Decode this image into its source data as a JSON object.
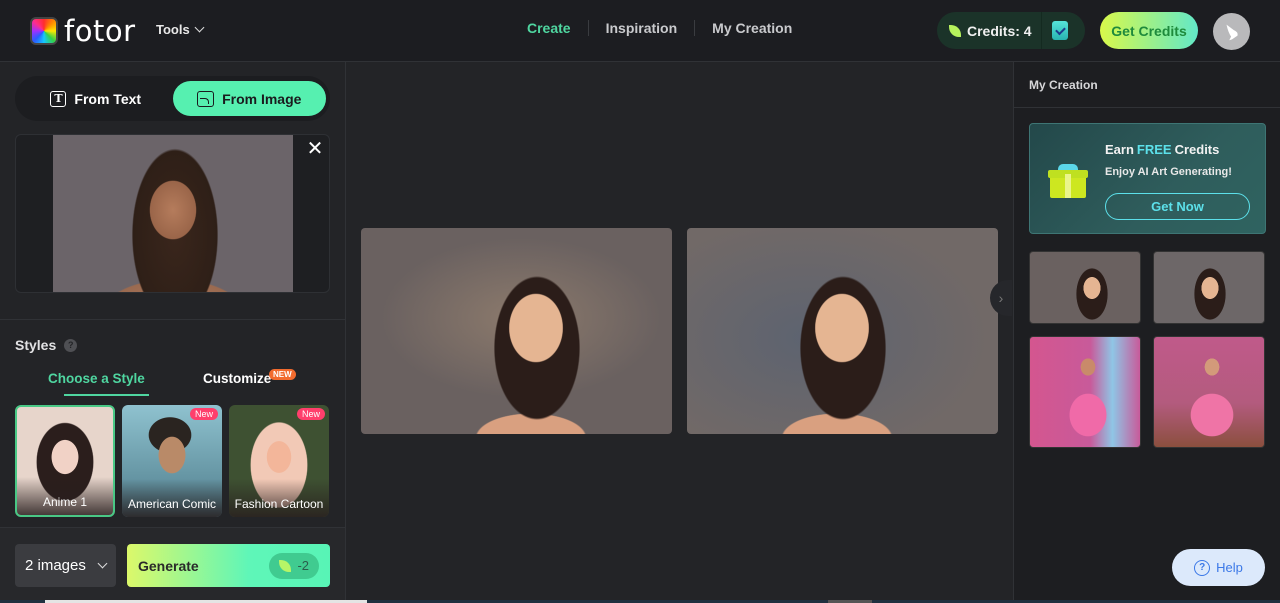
{
  "header": {
    "logo_text": "fotor",
    "tools_label": "Tools",
    "nav": [
      {
        "label": "Create",
        "active": true
      },
      {
        "label": "Inspiration",
        "active": false
      },
      {
        "label": "My Creation",
        "active": false
      }
    ],
    "credits_label": "Credits: 4",
    "get_credits_label": "Get Credits",
    "avatar_icon": "bird-icon"
  },
  "left_panel": {
    "mode_tabs": [
      {
        "label": "From Text",
        "icon": "text-icon",
        "active": false
      },
      {
        "label": "From Image",
        "icon": "image-icon",
        "active": true
      }
    ],
    "upload": {
      "has_image": true,
      "close_icon": "close-icon"
    },
    "styles": {
      "title": "Styles",
      "help_icon": "question-icon",
      "tabs": [
        {
          "label": "Choose a Style",
          "active": true
        },
        {
          "label": "Customize",
          "badge": "NEW",
          "active": false
        }
      ],
      "cards": [
        {
          "label": "Anime 1",
          "selected": true,
          "badge": ""
        },
        {
          "label": "American Comic",
          "selected": false,
          "badge": "New"
        },
        {
          "label": "Fashion Cartoon",
          "selected": false,
          "badge": "New"
        }
      ]
    },
    "image_count": "2 images",
    "generate_label": "Generate",
    "generate_cost": "-2"
  },
  "center": {
    "results": [
      {
        "name": "result-image-1"
      },
      {
        "name": "result-image-2"
      }
    ],
    "next_icon": "chevron-right-icon"
  },
  "right_panel": {
    "title": "My Creation",
    "promo": {
      "title_pre": "Earn",
      "title_free": "FREE",
      "title_post": "Credits",
      "subtitle": "Enjoy AI Art Generating!",
      "button": "Get Now"
    },
    "thumbnails": 4,
    "help_label": "Help"
  },
  "colors": {
    "accent": "#4fd6a0",
    "accent_button": "#56f0b0",
    "promo_cyan": "#5ce0ea",
    "new_badge": "#ff3f6c"
  }
}
